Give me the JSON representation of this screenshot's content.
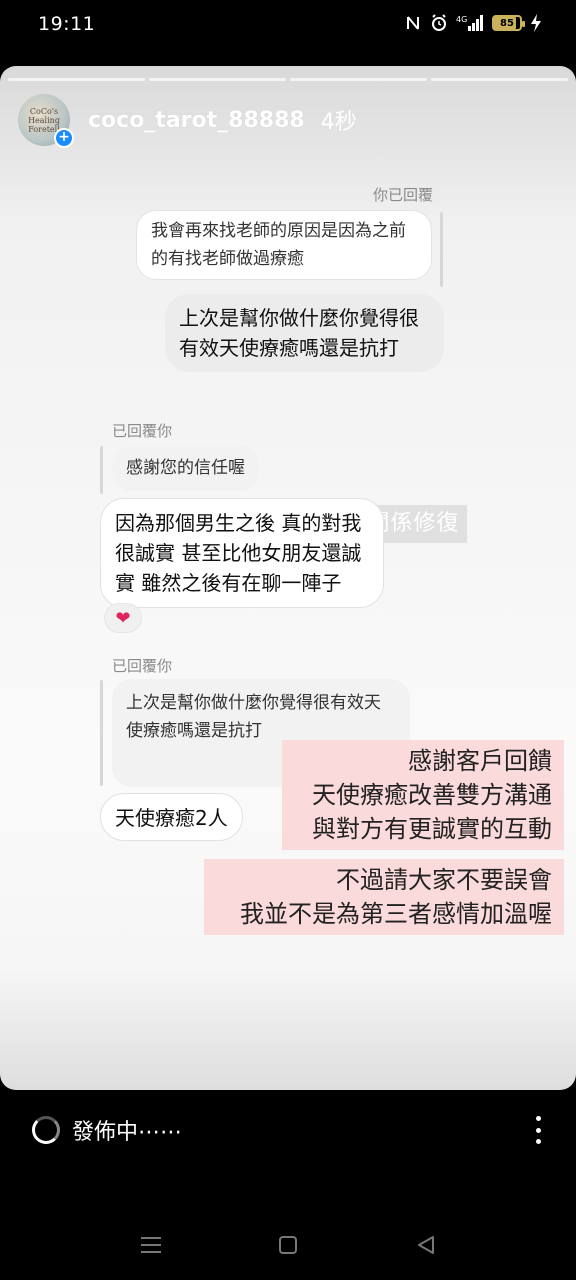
{
  "status_bar": {
    "time": "19:11",
    "icons": [
      "nfc-icon",
      "alarm-icon",
      "signal-4g-icon",
      "battery-icon",
      "charging-icon"
    ],
    "network": "4G",
    "battery_level": "85",
    "battery_fraction": 0.85
  },
  "story": {
    "progress_segments": 4,
    "username": "coco_tarot_88888",
    "time_ago": "4秒",
    "avatar_text": "CoCo's Healing Foretell",
    "hashtag": "#關係修復"
  },
  "chat": {
    "reply_label_1": "你已回覆",
    "quoted_1": "我會再來找老師的原因是因為之前的有找老師做過療癒",
    "msg_outgoing_1": "上次是幫你做什麼你覺得很有效天使療癒嗎還是抗打",
    "reply_label_2": "已回覆你",
    "quoted_2": "感謝您的信任喔",
    "msg_incoming_1": "因為那個男生之後 真的對我很誠實 甚至比他女朋友還誠實  雖然之後有在聊一陣子",
    "reaction": "❤",
    "reply_label_3": "已回覆你",
    "quoted_3": "上次是幫你做什麼你覺得很有效天使療癒嗎還是抗打",
    "msg_incoming_2": "天使療癒2人"
  },
  "overlays": {
    "text_1_line_1": "感謝客戶回饋",
    "text_1_line_2": "天使療癒改善雙方溝通",
    "text_1_line_3": "與對方有更誠實的互動",
    "text_2_line_1": "不過請大家不要誤會",
    "text_2_line_2": "我並不是為第三者感情加溫喔"
  },
  "bottom_bar": {
    "posting_label": "發佈中⋯⋯"
  },
  "colors": {
    "overlay_bg": "#fadada",
    "avatar_badge": "#1a8cff",
    "battery": "#c9b25a"
  }
}
